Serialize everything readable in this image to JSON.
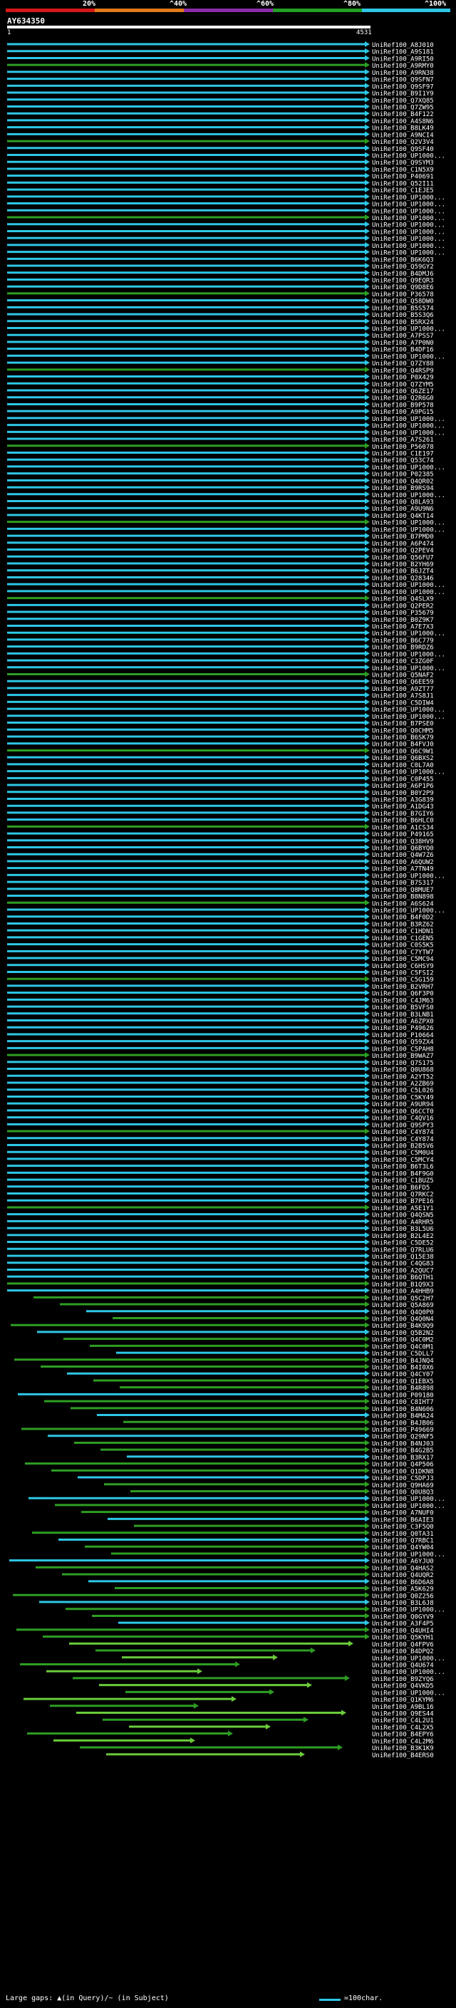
{
  "title": "AY634350",
  "query": {
    "start": "1",
    "end": "4531"
  },
  "color_scale": {
    "labels": [
      "20%",
      "^40%",
      "^60%",
      "^80%",
      "^100%"
    ],
    "colors": [
      "#d61818",
      "#e07a1a",
      "#8a2ca8",
      "#22a022",
      "#2ec7e6"
    ]
  },
  "legend": {
    "gaps_text": "Large gaps: ▲(in Query)/~ (in Subject)",
    "scale_text": "=100char."
  },
  "hit_colors": {
    "blue": "#2ec7e6",
    "green": "#2e9e23",
    "dim_green": "#6acb3a"
  },
  "hits": [
    "UniRef100_A8J010",
    "UniRef100_A9S181",
    "UniRef100_A9RI50",
    "UniRef100_A9RMY0",
    "UniRef100_A9RN38",
    "UniRef100_Q9SFN7",
    "UniRef100_Q9SF97",
    "UniRef100_B9I1Y9",
    "UniRef100_Q7XQ85",
    "UniRef100_Q7ZW95",
    "UniRef100_B4F122",
    "UniRef100_A4S8N6",
    "UniRef100_B8LK49",
    "UniRef100_A9NCI4",
    "UniRef100_Q2V3V4",
    "UniRef100_Q9SF40",
    "UniRef100_UP1000...",
    "UniRef100_Q9SYM3",
    "UniRef100_C1N5X9",
    "UniRef100_P40691",
    "UniRef100_Q52I11",
    "UniRef100_C1EJE5",
    "UniRef100_UP1000...",
    "UniRef100_UP1000...",
    "UniRef100_UP1000...",
    "UniRef100_UP1000...",
    "UniRef100_UP1000...",
    "UniRef100_UP1000...",
    "UniRef100_UP1000...",
    "UniRef100_UP1000...",
    "UniRef100_UP1000...",
    "UniRef100_B6K6Q3",
    "UniRef100_Q59GY2",
    "UniRef100_B4DMJ6",
    "UniRef100_Q9EQR3",
    "UniRef100_Q9D8E6",
    "UniRef100_P36578",
    "UniRef100_Q58DW0",
    "UniRef100_B5S574",
    "UniRef100_B5S3Q6",
    "UniRef100_B5RX24",
    "UniRef100_UP1000...",
    "UniRef100_A7PSS7",
    "UniRef100_A7P0N0",
    "UniRef100_B4DF16",
    "UniRef100_UP1000...",
    "UniRef100_Q7ZY88",
    "UniRef100_Q4RSP9",
    "UniRef100_P0X429",
    "UniRef100_Q7ZYM5",
    "UniRef100_Q6ZE17",
    "UniRef100_Q2R6G0",
    "UniRef100_B9P578",
    "UniRef100_A9PG15",
    "UniRef100_UP1000...",
    "UniRef100_UP1000...",
    "UniRef100_UP1000...",
    "UniRef100_A7S261",
    "UniRef100_P56078",
    "UniRef100_C1E197",
    "UniRef100_Q53C74",
    "UniRef100_UP1000...",
    "UniRef100_P02385",
    "UniRef100_Q4QR02",
    "UniRef100_B9RS94",
    "UniRef100_UP1000...",
    "UniRef100_Q8LA93",
    "UniRef100_A9U9N6",
    "UniRef100_Q4KT14",
    "UniRef100_UP1000...",
    "UniRef100_UP1000...",
    "UniRef100_B7PMD0",
    "UniRef100_A6P474",
    "UniRef100_Q2PEV4",
    "UniRef100_Q56FU7",
    "UniRef100_B2YH69",
    "UniRef100_B6JZT4",
    "UniRef100_Q28346",
    "UniRef100_UP1000...",
    "UniRef100_UP1000...",
    "UniRef100_Q4SLX9",
    "UniRef100_Q2PER2",
    "UniRef100_P35679",
    "UniRef100_B0Z9K7",
    "UniRef100_A7E7X3",
    "UniRef100_UP1000...",
    "UniRef100_B6C779",
    "UniRef100_B9RDZ6",
    "UniRef100_UP1000...",
    "UniRef100_C3ZG0F",
    "UniRef100_UP1000...",
    "UniRef100_Q5NAF2",
    "UniRef100_Q6EE59",
    "UniRef100_A9ZT77",
    "UniRef100_A7S8J1",
    "UniRef100_C5DIW4",
    "UniRef100_UP1000...",
    "UniRef100_UP1000...",
    "UniRef100_B7PSE0",
    "UniRef100_Q0CHM5",
    "UniRef100_B6SK79",
    "UniRef100_B4FVJ0",
    "UniRef100_Q6C9W1",
    "UniRef100_Q6BXS2",
    "UniRef100_C0L7A0",
    "UniRef100_UP1000...",
    "UniRef100_C0P455",
    "UniRef100_A6P1P6",
    "UniRef100_B0Y2P9",
    "UniRef100_A3G839",
    "UniRef100_A1DG43",
    "UniRef100_B7GIY6",
    "UniRef100_B6HLC0",
    "UniRef100_A1CS34",
    "UniRef100_P49165",
    "UniRef100_Q38HV9",
    "UniRef100_Q6BYQ0",
    "UniRef100_Q4W7Z6",
    "UniRef100_A6QUW2",
    "UniRef100_A7TN49",
    "UniRef100_UP1000...",
    "UniRef100_B7S317",
    "UniRef100_Q8MUE7",
    "UniRef100_B8N898",
    "UniRef100_A6S624",
    "UniRef100_UP1000...",
    "UniRef100_B4F0D2",
    "UniRef100_B3RZ62",
    "UniRef100_C1HDN1",
    "UniRef100_C1GEN5",
    "UniRef100_C0S5K5",
    "UniRef100_C7YTW7",
    "UniRef100_C5MC94",
    "UniRef100_C6HSY9",
    "UniRef100_C5FSI2",
    "UniRef100_C5G159",
    "UniRef100_B2VRH7",
    "UniRef100_Q6F3P0",
    "UniRef100_C4JM63",
    "UniRef100_B5VFS0",
    "UniRef100_B3LNB1",
    "UniRef100_A6ZPX0",
    "UniRef100_P49626",
    "UniRef100_P10664",
    "UniRef100_Q59ZX4",
    "UniRef100_C5PAH8",
    "UniRef100_B9WAZ7",
    "UniRef100_Q7S175",
    "UniRef100_Q0U868",
    "UniRef100_A2YT52",
    "UniRef100_A2ZB69",
    "UniRef100_C5L026",
    "UniRef100_C5KY49",
    "UniRef100_A9UR94",
    "UniRef100_Q6CCT0",
    "UniRef100_C4QV16",
    "UniRef100_Q9SPY3",
    "UniRef100_C4Y874",
    "UniRef100_C4Y874",
    "UniRef100_B2B5V6",
    "UniRef100_C5M0U4",
    "UniRef100_C5MCY4",
    "UniRef100_B6T3L6",
    "UniRef100_B4F9G0",
    "UniRef100_C1BUZ5",
    "UniRef100_B6FD5",
    "UniRef100_Q7RKC2",
    "UniRef100_B7PE16",
    "UniRef100_A5E1Y1",
    "UniRef100_Q4QSN5",
    "UniRef100_A4RHR5",
    "UniRef100_B3L5U6",
    "UniRef100_B2L4E2",
    "UniRef100_C5DE52",
    "UniRef100_Q7RLU6",
    "UniRef100_Q15E38",
    "UniRef100_C4QG83",
    "UniRef100_A2QUC7",
    "UniRef100_B6QTH1",
    "UniRef100_B1Q9X3",
    "UniRef100_A4HHB9",
    "UniRef100_Q5C2H7",
    "UniRef100_Q5A869",
    "UniRef100_Q4Q0P0",
    "UniRef100_Q4Q0N4",
    "UniRef100_B4K9Q9",
    "UniRef100_Q5B2N2",
    "UniRef100_Q4C0M2",
    "UniRef100_Q4C0M1",
    "UniRef100_C5DLL7",
    "UniRef100_B4JNQ4",
    "UniRef100_B4I0X6",
    "UniRef100_Q4CY07",
    "UniRef100_Q1EBX5",
    "UniRef100_B4R898",
    "UniRef100_P09180",
    "UniRef100_C8IHT7",
    "UniRef100_B4N606",
    "UniRef100_B4MA24",
    "UniRef100_B4JB06",
    "UniRef100_P49669",
    "UniRef100_Q29NF5",
    "UniRef100_B4NJ03",
    "UniRef100_B4G2B5",
    "UniRef100_B3RX17",
    "UniRef100_Q4P506",
    "UniRef100_Q1DKN8",
    "UniRef100_C5DPJ3",
    "UniRef100_Q9HA69",
    "UniRef100_Q0U8Q3",
    "UniRef100_UP1000...",
    "UniRef100_UP1000...",
    "UniRef100_A7NUF0",
    "UniRef100_B6AIE3",
    "UniRef100_C3F5Q0",
    "UniRef100_Q0TA31",
    "UniRef100_Q7RBC1",
    "UniRef100_Q4YW04",
    "UniRef100_UP1000...",
    "UniRef100_A6YJU0",
    "UniRef100_Q4HAS2",
    "UniRef100_Q4UQR2",
    "UniRef100_B6D6A8",
    "UniRef100_A5K629",
    "UniRef100_Q0Z256",
    "UniRef100_B3L6J8",
    "UniRef100_UP1000...",
    "UniRef100_Q0GYV9",
    "UniRef100_A3F4P5",
    "UniRef100_Q4UHI4",
    "UniRef100_Q5KYH1",
    "UniRef100_Q4FPV6",
    "UniRef100_B4DPQ2",
    "UniRef100_UP1000...",
    "UniRef100_Q4U674",
    "UniRef100_UP1000...",
    "UniRef100_B9ZYQ6",
    "UniRef100_Q4VKD5",
    "UniRef100_UP1000...",
    "UniRef100_Q1KYM6",
    "UniRef100_A9BL16",
    "UniRef100_Q9ES44",
    "UniRef100_C4L2U1",
    "UniRef100_C4L2X5",
    "UniRef100_B4EPY6",
    "UniRef100_C4L2M6",
    "UniRef100_B3K1K9",
    "UniRef100_B4ERS0"
  ]
}
